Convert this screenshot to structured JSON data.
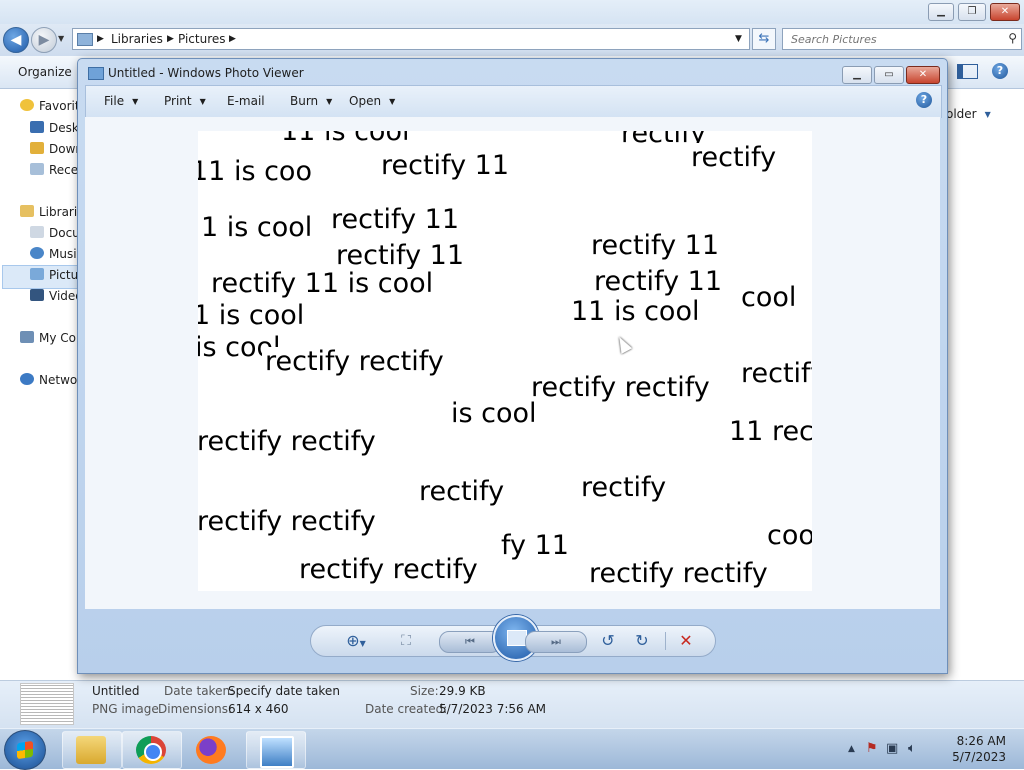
{
  "explorer": {
    "breadcrumb": [
      "Libraries",
      "Pictures"
    ],
    "search_placeholder": "Search Pictures",
    "toolbar": {
      "organize": "Organize",
      "folder_fragment": "older"
    },
    "nav": {
      "favorites": "Favorit",
      "desktop": "Deskt",
      "downloads": "Down",
      "recent": "Rece",
      "libraries": "Librarie",
      "documents": "Docu",
      "music": "Musi",
      "pictures": "Pictu",
      "videos": "Video",
      "computer": "My Co",
      "network": "Netwo"
    },
    "status": {
      "filename": "Untitled",
      "filetype": "PNG image",
      "date_taken_label": "Date taken:",
      "date_taken_value": "Specify date taken",
      "dimensions_label": "Dimensions:",
      "dimensions_value": "614 x 460",
      "size_label": "Size:",
      "size_value": "29.9 KB",
      "date_created_label": "Date created:",
      "date_created_value": "5/7/2023 7:56 AM"
    }
  },
  "viewer": {
    "title": "Untitled - Windows Photo Viewer",
    "menu": {
      "file": "File",
      "print": "Print",
      "email": "E-mail",
      "burn": "Burn",
      "open": "Open"
    },
    "help": "?",
    "image_words": [
      "11 is cool",
      "rectify 11",
      "rectify",
      "rectify 11 is cool",
      "rectify rectify",
      "is cool",
      "cool",
      "11 is coo",
      "fy 11",
      "1 is cool",
      "11 rec"
    ]
  },
  "taskbar": {
    "time": "8:26 AM",
    "date": "5/7/2023"
  }
}
